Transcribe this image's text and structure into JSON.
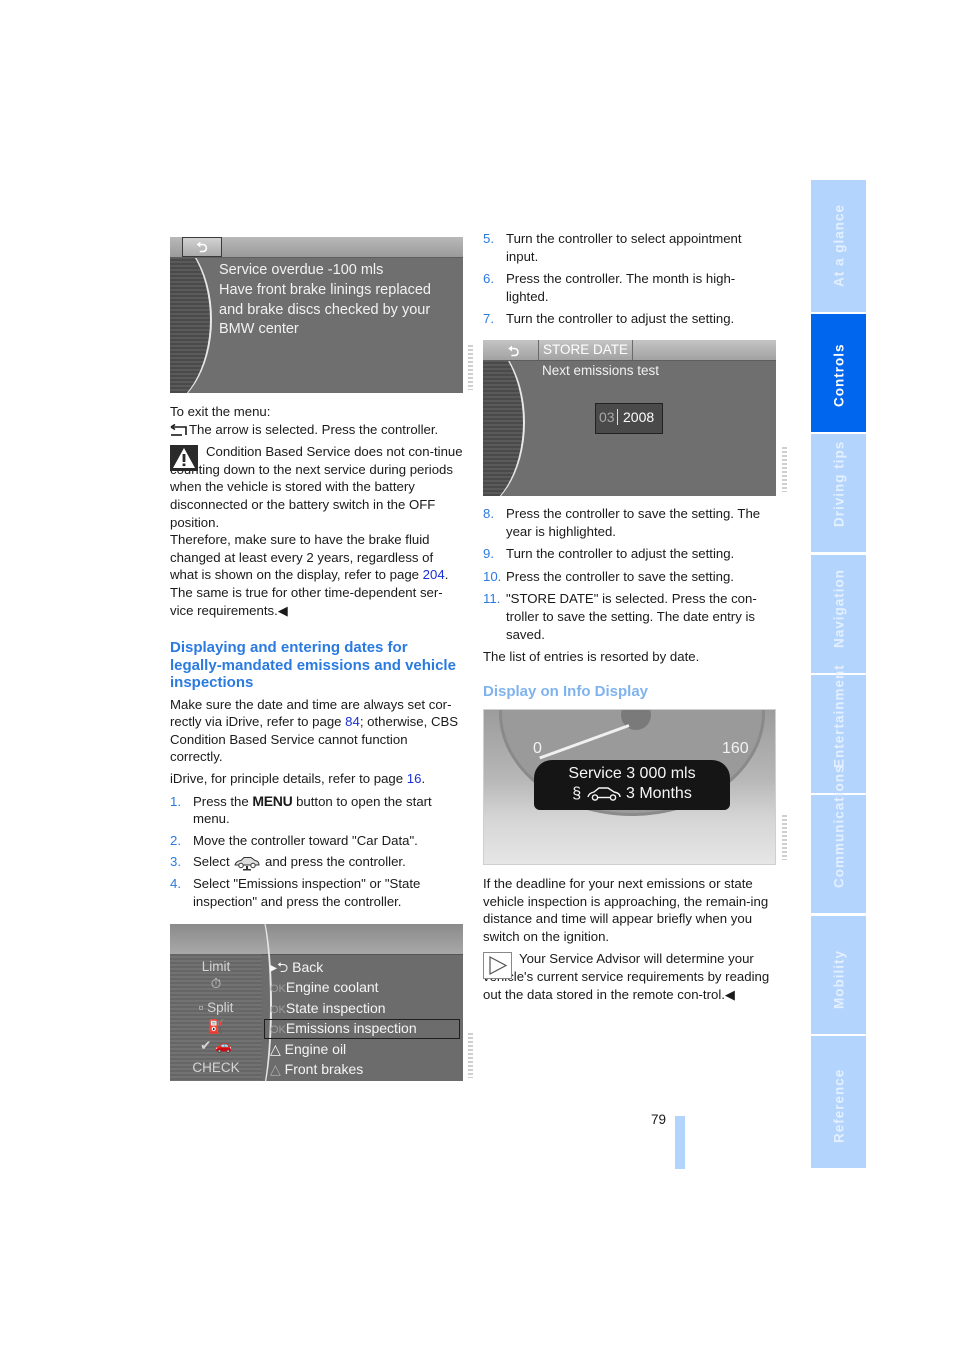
{
  "screenshot1": {
    "back_icon": "return-arrow-icon",
    "lines": [
      "Service overdue -100 mls",
      "Have front brake linings replaced",
      "and brake discs checked by your",
      "BMW center"
    ]
  },
  "left": {
    "exit_intro": "To exit the menu:",
    "exit_text": "The arrow is selected. Press the controller.",
    "warning": {
      "icon": "warning-triangle-icon",
      "text_before_link": "Condition Based Service does not con-tinue counting down to the next service during periods when the vehicle is stored with the battery disconnected or the battery switch in the OFF position.",
      "text2_before_link": "Therefore, make sure to have the brake fluid changed at least every 2 years, regardless of what is shown on the display, refer to page ",
      "link_page": "204",
      "text2_after_link": ". The same is true for other time-dependent ser-vice requirements.",
      "end_mark": "◀"
    },
    "heading": "Displaying and entering dates for legally-mandated emissions and vehicle inspections",
    "para1_before": "Make sure the date and time are always set cor-rectly via iDrive, refer to page ",
    "para1_link": "84",
    "para1_after": "; otherwise, CBS Condition Based Service cannot function correctly.",
    "para2_before": "iDrive, for principle details, refer to page ",
    "para2_link": "16",
    "para2_after": ".",
    "steps": [
      {
        "num": "1.",
        "before": "Press the ",
        "bold": "MENU",
        "after": " button to open the start menu."
      },
      {
        "num": "2.",
        "text": "Move the controller toward \"Car Data\"."
      },
      {
        "num": "3.",
        "before": "Select ",
        "icon": "car-data-icon",
        "after": " and press the controller."
      },
      {
        "num": "4.",
        "text": "Select \"Emissions inspection\" or \"State inspection\" and press the controller."
      }
    ]
  },
  "screenshot3": {
    "left_items": [
      "Limit",
      "⏱",
      "Split",
      "oil-can",
      "car",
      "CHECK"
    ],
    "menu_items": [
      {
        "prefix": "",
        "icon": "back-arrow-icon",
        "label": "Back"
      },
      {
        "prefix": "OK",
        "label": "Engine coolant"
      },
      {
        "prefix": "OK",
        "label": "State inspection"
      },
      {
        "prefix": "OK",
        "label": "Emissions inspection",
        "selected": true
      },
      {
        "prefix": "△",
        "label": "Engine oil"
      },
      {
        "prefix": "△",
        "label": "Front brakes"
      }
    ]
  },
  "right": {
    "steps_a": [
      {
        "num": "5.",
        "text": "Turn the controller to select appointment input."
      },
      {
        "num": "6.",
        "text": "Press the controller. The month is high-lighted."
      },
      {
        "num": "7.",
        "text": "Turn the controller to adjust the setting."
      }
    ],
    "steps_b": [
      {
        "num": "8.",
        "text": "Press the controller to save the setting. The year is highlighted."
      },
      {
        "num": "9.",
        "text": "Turn the controller to adjust the setting."
      },
      {
        "num": "10.",
        "text": "Press the controller to save the setting."
      },
      {
        "num": "11.",
        "text": "\"STORE DATE\" is selected. Press the con-troller to save the setting. The date entry is saved."
      }
    ],
    "resorted": "The list of entries is resorted by date.",
    "heading": "Display on Info Display",
    "para": "If the deadline for your next emissions or state vehicle inspection is approaching, the remain-ing distance and time will appear briefly when you switch on the ignition.",
    "note": {
      "icon": "note-triangle-icon",
      "text": "Your Service Advisor will determine your vehicle's current service requirements by reading out the data stored in the remote con-trol.",
      "end_mark": "◀"
    }
  },
  "screenshot2": {
    "tab_label": "STORE DATE",
    "title": "Next  emissions test",
    "month": "03",
    "year": "2008"
  },
  "info_display": {
    "gauge_min": "0",
    "gauge_max": "160",
    "line1": "Service 3 000 mls",
    "line2_prefix": "§",
    "line2": "3 Months"
  },
  "sidebar": {
    "tabs": [
      {
        "label": "At a glance",
        "active": false
      },
      {
        "label": "Controls",
        "active": true
      },
      {
        "label": "Driving tips",
        "active": false
      },
      {
        "label": "Navigation",
        "active": false
      },
      {
        "label": "Entertainment",
        "active": false
      },
      {
        "label": "Communications",
        "active": false
      },
      {
        "label": "Mobility",
        "active": false
      },
      {
        "label": "Reference",
        "active": false
      }
    ]
  },
  "footer": {
    "page_number": "79",
    "accent_color": "#b3d4fc",
    "active_tab_color": "#0066ee",
    "heading_color": "#2a7ae0"
  }
}
